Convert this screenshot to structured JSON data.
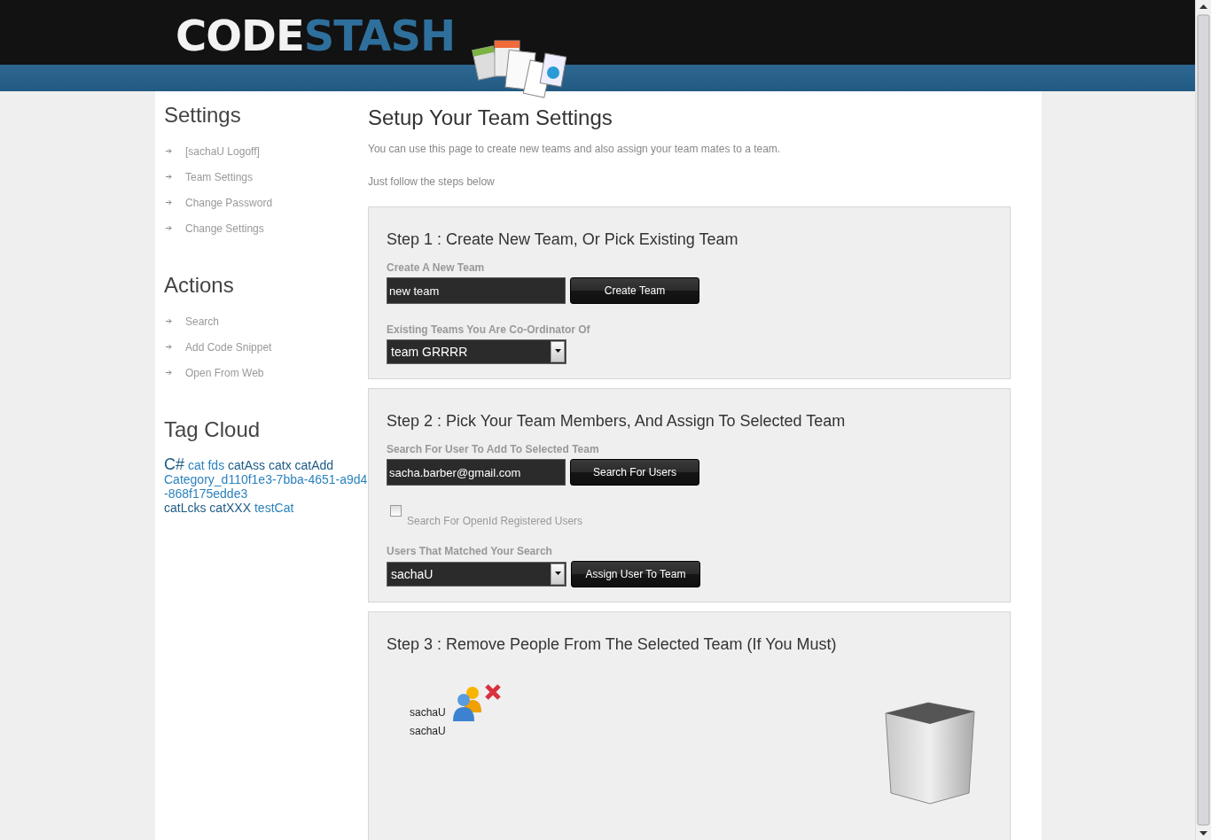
{
  "logo": {
    "first": "CODE",
    "second": "STASH"
  },
  "sidebar": {
    "sections": [
      {
        "title": "Settings",
        "items": [
          "[sachaU Logoff]",
          "Team Settings",
          "Change Password",
          "Change Settings"
        ]
      },
      {
        "title": "Actions",
        "items": [
          "Search",
          "Add Code Snippet",
          "Open From Web"
        ]
      }
    ],
    "tag_cloud": {
      "title": "Tag Cloud",
      "tags": [
        {
          "label": "C#",
          "kind": "large",
          "color": "#1c5a86"
        },
        {
          "label": "cat",
          "kind": "small",
          "color": "#2b82be"
        },
        {
          "label": "fds",
          "kind": "small",
          "color": "#2b82be"
        },
        {
          "label": "catAss",
          "kind": "small",
          "color": "#1c5a86"
        },
        {
          "label": "catx",
          "kind": "small",
          "color": "#1c5a86"
        },
        {
          "label": "catAdd",
          "kind": "small",
          "color": "#1c5a86"
        },
        {
          "label": "Category_d110f1e3-7bba-4651-a9d4-868f175edde3",
          "kind": "small",
          "color": "#2b82be"
        },
        {
          "label": "catLcks",
          "kind": "small",
          "color": "#1c5a86"
        },
        {
          "label": "catXXX",
          "kind": "small",
          "color": "#1c5a86"
        },
        {
          "label": "testCat",
          "kind": "small",
          "color": "#2b82be"
        }
      ]
    }
  },
  "main": {
    "title": "Setup Your Team Settings",
    "intro": "You can use this page to create new teams and also assign your team mates to a team.",
    "hint": "Just follow the steps below",
    "step1": {
      "heading": "Step 1 : Create New Team, Or Pick Existing Team",
      "new_team_label": "Create A New Team",
      "new_team_value": "new team",
      "create_button": "Create Team",
      "existing_label": "Existing Teams You Are Co-Ordinator Of",
      "existing_value": "team GRRRR"
    },
    "step2": {
      "heading": "Step 2 : Pick Your Team Members, And Assign To Selected Team",
      "search_label": "Search For User To Add To Selected Team",
      "search_value": "sacha.barber@gmail.com",
      "search_button": "Search For Users",
      "openid": {
        "label": "Search For OpenId Registered Users",
        "checked": false
      },
      "matched_label": "Users That Matched Your Search",
      "matched_value": "sachaU",
      "assign_button": "Assign User To Team"
    },
    "step3": {
      "heading": "Step 3 : Remove People From The Selected Team (If You Must)",
      "members": [
        "sachaU",
        "sachaU"
      ]
    }
  }
}
